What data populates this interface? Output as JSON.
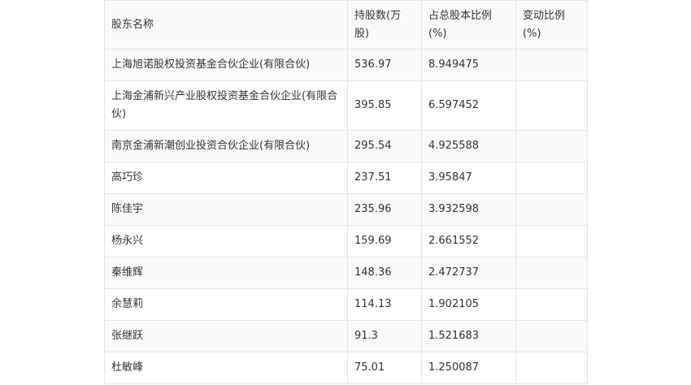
{
  "table": {
    "headers": [
      "股东名称",
      "持股数(万股)",
      "占总股本比例(%)",
      "变动比例(%)"
    ],
    "rows": [
      [
        "上海旭诺股权投资基金合伙企业(有限合伙)",
        "536.97",
        "8.949475",
        ""
      ],
      [
        "上海金浦新兴产业股权投资基金合伙企业(有限合伙)",
        "395.85",
        "6.597452",
        ""
      ],
      [
        "南京金浦新潮创业投资合伙企业(有限合伙)",
        "295.54",
        "4.925588",
        ""
      ],
      [
        "高巧珍",
        "237.51",
        "3.95847",
        ""
      ],
      [
        "陈佳宇",
        "235.96",
        "3.932598",
        ""
      ],
      [
        "杨永兴",
        "159.69",
        "2.661552",
        ""
      ],
      [
        "秦维辉",
        "148.36",
        "2.472737",
        ""
      ],
      [
        "余慧莉",
        "114.13",
        "1.902105",
        ""
      ],
      [
        "张继跃",
        "91.3",
        "1.521683",
        ""
      ],
      [
        "杜敏峰",
        "75.01",
        "1.250087",
        ""
      ]
    ]
  }
}
